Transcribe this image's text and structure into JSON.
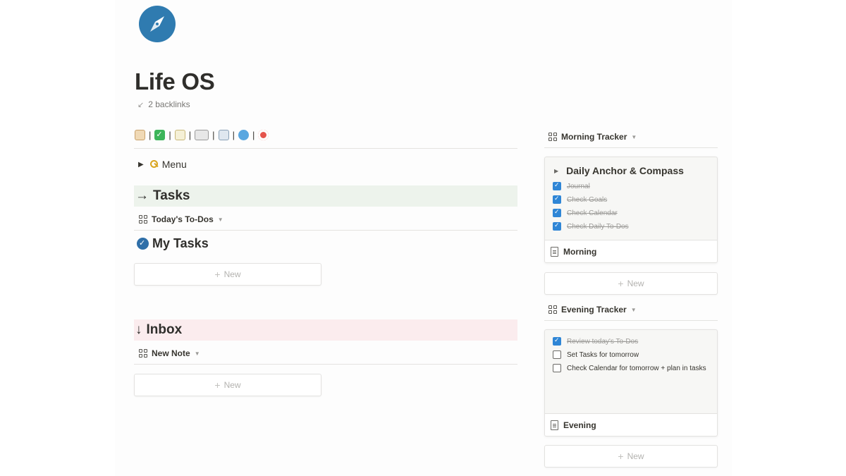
{
  "page": {
    "title": "Life OS",
    "backlinks": "2 backlinks",
    "icon": "compass-icon"
  },
  "nav": {
    "items": [
      "house-emoji",
      "check-mark-emoji",
      "memo-emoji",
      "writing-hand-emoji",
      "book-emoji",
      "globe-emoji",
      "target-emoji"
    ],
    "separator": "|"
  },
  "menu_toggle": {
    "label": "Menu"
  },
  "tasks": {
    "heading": "Tasks",
    "view_tab": "Today's To-Dos",
    "subheading": "My Tasks",
    "new_label": "New"
  },
  "inbox": {
    "heading": "Inbox",
    "view_tab": "New Note",
    "new_label": "New"
  },
  "morning": {
    "view_tab": "Morning Tracker",
    "toggle_title": "Daily Anchor & Compass",
    "todos": [
      {
        "text": "Journal",
        "checked": true
      },
      {
        "text": "Check Goals",
        "checked": true
      },
      {
        "text": "Check Calendar",
        "checked": true
      },
      {
        "text": "Check Daily To-Dos",
        "checked": true
      }
    ],
    "card_title": "Morning",
    "new_label": "New"
  },
  "evening": {
    "view_tab": "Evening Tracker",
    "todos": [
      {
        "text": "Review today's To-Dos",
        "checked": true
      },
      {
        "text": "Set Tasks for tomorrow",
        "checked": false
      },
      {
        "text": "Check Calendar for tomorrow + plan in tasks",
        "checked": false
      }
    ],
    "card_title": "Evening",
    "new_label": "New"
  },
  "colors": {
    "tasks_bg": "#edf3ec",
    "inbox_bg": "#fbecee",
    "checkbox_blue": "#2f86d6",
    "icon_blue": "#2f7bb0"
  }
}
